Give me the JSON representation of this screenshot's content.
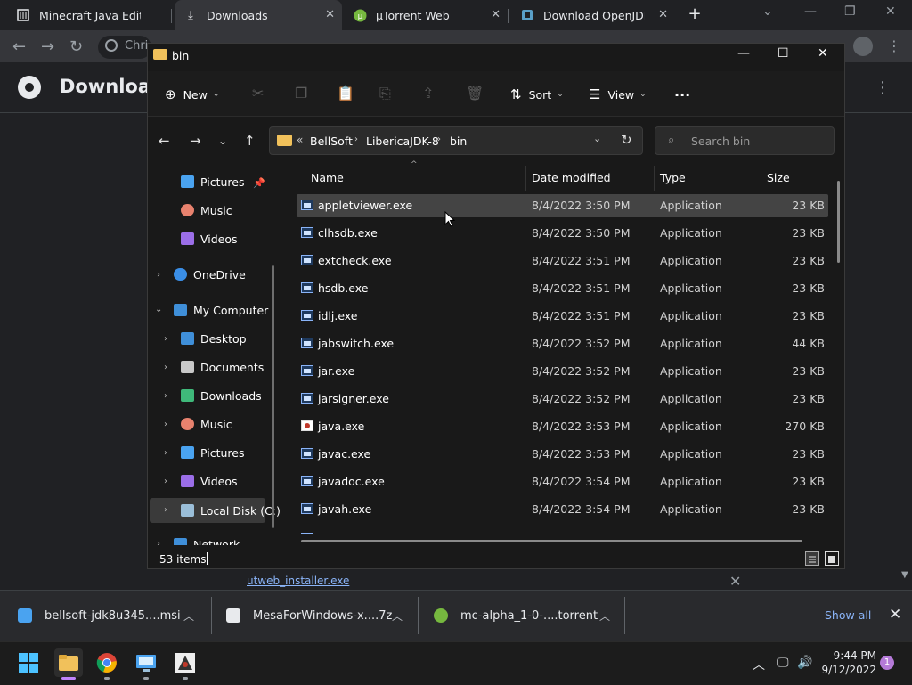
{
  "browser": {
    "tabs": [
      {
        "label": "Minecraft Java Edition (",
        "icon": "minecraft-icon"
      },
      {
        "label": "Downloads",
        "icon": "download-icon"
      },
      {
        "label": "µTorrent Web",
        "icon": "utorrent-icon"
      },
      {
        "label": "Download OpenJDK bu",
        "icon": "openjdk-icon"
      }
    ],
    "address_text": "Chri",
    "page_title": "Download"
  },
  "explorer": {
    "title": "bin",
    "commands": {
      "new": "New",
      "sort": "Sort",
      "view": "View",
      "more": "..."
    },
    "breadcrumb": [
      "BellSoft",
      "LibericaJDK-8",
      "bin"
    ],
    "breadcrumb_overflow": "«",
    "search_placeholder": "Search bin",
    "nav": {
      "quick": [
        {
          "label": "Pictures",
          "icon": "pictures-icon",
          "color": "#4aa3f0"
        },
        {
          "label": "Music",
          "icon": "music-icon",
          "color": "#e8826e"
        },
        {
          "label": "Videos",
          "icon": "videos-icon",
          "color": "#9b6ee8"
        }
      ],
      "onedrive": "OneDrive",
      "computer": "My Computer",
      "children": [
        {
          "label": "Desktop",
          "icon": "desktop-icon",
          "color": "#3f8fd9"
        },
        {
          "label": "Documents",
          "icon": "documents-icon",
          "color": "#c8c8c8"
        },
        {
          "label": "Downloads",
          "icon": "downloads-icon",
          "color": "#3fb97a"
        },
        {
          "label": "Music",
          "icon": "music-icon",
          "color": "#e8826e"
        },
        {
          "label": "Pictures",
          "icon": "pictures-icon",
          "color": "#4aa3f0"
        },
        {
          "label": "Videos",
          "icon": "videos-icon",
          "color": "#9b6ee8"
        },
        {
          "label": "Local Disk (C:)",
          "icon": "disk-icon",
          "color": "#9bbfd9"
        }
      ],
      "network": "Network"
    },
    "columns": {
      "name": "Name",
      "date": "Date modified",
      "type": "Type",
      "size": "Size"
    },
    "files": [
      {
        "name": "appletviewer.exe",
        "date": "8/4/2022 3:50 PM",
        "type": "Application",
        "size": "23 KB"
      },
      {
        "name": "clhsdb.exe",
        "date": "8/4/2022 3:50 PM",
        "type": "Application",
        "size": "23 KB"
      },
      {
        "name": "extcheck.exe",
        "date": "8/4/2022 3:51 PM",
        "type": "Application",
        "size": "23 KB"
      },
      {
        "name": "hsdb.exe",
        "date": "8/4/2022 3:51 PM",
        "type": "Application",
        "size": "23 KB"
      },
      {
        "name": "idlj.exe",
        "date": "8/4/2022 3:51 PM",
        "type": "Application",
        "size": "23 KB"
      },
      {
        "name": "jabswitch.exe",
        "date": "8/4/2022 3:52 PM",
        "type": "Application",
        "size": "44 KB"
      },
      {
        "name": "jar.exe",
        "date": "8/4/2022 3:52 PM",
        "type": "Application",
        "size": "23 KB"
      },
      {
        "name": "jarsigner.exe",
        "date": "8/4/2022 3:52 PM",
        "type": "Application",
        "size": "23 KB"
      },
      {
        "name": "java.exe",
        "date": "8/4/2022 3:53 PM",
        "type": "Application",
        "size": "270 KB"
      },
      {
        "name": "javac.exe",
        "date": "8/4/2022 3:53 PM",
        "type": "Application",
        "size": "23 KB"
      },
      {
        "name": "javadoc.exe",
        "date": "8/4/2022 3:54 PM",
        "type": "Application",
        "size": "23 KB"
      },
      {
        "name": "javah.exe",
        "date": "8/4/2022 3:54 PM",
        "type": "Application",
        "size": "23 KB"
      }
    ],
    "status": "53 items"
  },
  "downloads_page": {
    "partial_item": "utweb_installer.exe"
  },
  "shelf": {
    "items": [
      {
        "label": "bellsoft-jdk8u345....msi"
      },
      {
        "label": "MesaForWindows-x....7z"
      },
      {
        "label": "mc-alpha_1-0-....torrent"
      }
    ],
    "show_all": "Show all"
  },
  "taskbar": {
    "time": "9:44 PM",
    "date": "9/12/2022",
    "notifications": "1"
  },
  "colors": {
    "accent_link": "#8ab4f8",
    "folder": "#f1c15b",
    "selection": "#444444"
  }
}
